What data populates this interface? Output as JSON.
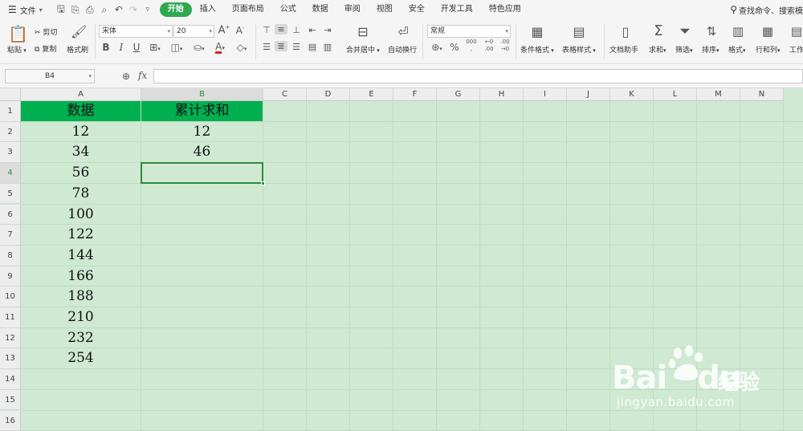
{
  "menu": {
    "file_label": "文件",
    "tabs": [
      {
        "label": "开始",
        "active": true
      },
      {
        "label": "插入"
      },
      {
        "label": "页面布局"
      },
      {
        "label": "公式"
      },
      {
        "label": "数据"
      },
      {
        "label": "审阅"
      },
      {
        "label": "视图"
      },
      {
        "label": "安全"
      },
      {
        "label": "开发工具"
      },
      {
        "label": "特色应用"
      }
    ],
    "search_label": "查找命令、搜索模"
  },
  "ribbon": {
    "paste": "粘贴",
    "cut": "剪切",
    "copy": "复制",
    "format_painter": "格式刷",
    "font_name": "宋体",
    "font_size": "20",
    "bold": "B",
    "italic": "I",
    "underline": "U",
    "font_color_glyph": "A",
    "font_color": "#e02020",
    "merge_center": "合并居中",
    "wrap_text": "自动换行",
    "number_format": "常规",
    "percent": "%",
    "thousands": "000",
    "inc_decimal": ".00",
    "dec_decimal": ".00",
    "cond_format": "条件格式",
    "table_style": "表格样式",
    "doc_helper": "文档助手",
    "sum": "求和",
    "filter": "筛选",
    "sort": "排序",
    "format": "格式",
    "row_col": "行和列",
    "worksheet": "工作"
  },
  "formula_bar": {
    "name_box": "B4",
    "fx_label": "fx",
    "formula": ""
  },
  "sheet": {
    "columns": [
      "A",
      "B",
      "C",
      "D",
      "E",
      "F",
      "G",
      "H",
      "I",
      "J",
      "K",
      "L",
      "M",
      "N"
    ],
    "rows": [
      "1",
      "2",
      "3",
      "4",
      "5",
      "6",
      "7",
      "8",
      "9",
      "10",
      "11",
      "12",
      "13",
      "14",
      "15",
      "16"
    ],
    "selected_cell": "B4",
    "header_fill": "#00b050",
    "selection_color": "#2e8b3d",
    "A1": "数据",
    "B1": "累计求和",
    "col_a": [
      "12",
      "34",
      "56",
      "78",
      "100",
      "122",
      "144",
      "166",
      "188",
      "210",
      "232",
      "254"
    ],
    "col_b": [
      "12",
      "46"
    ]
  },
  "watermark": {
    "logo": "Bai",
    "logo_tail": "du",
    "cn": "经验",
    "url": "jingyan.baidu.com"
  }
}
